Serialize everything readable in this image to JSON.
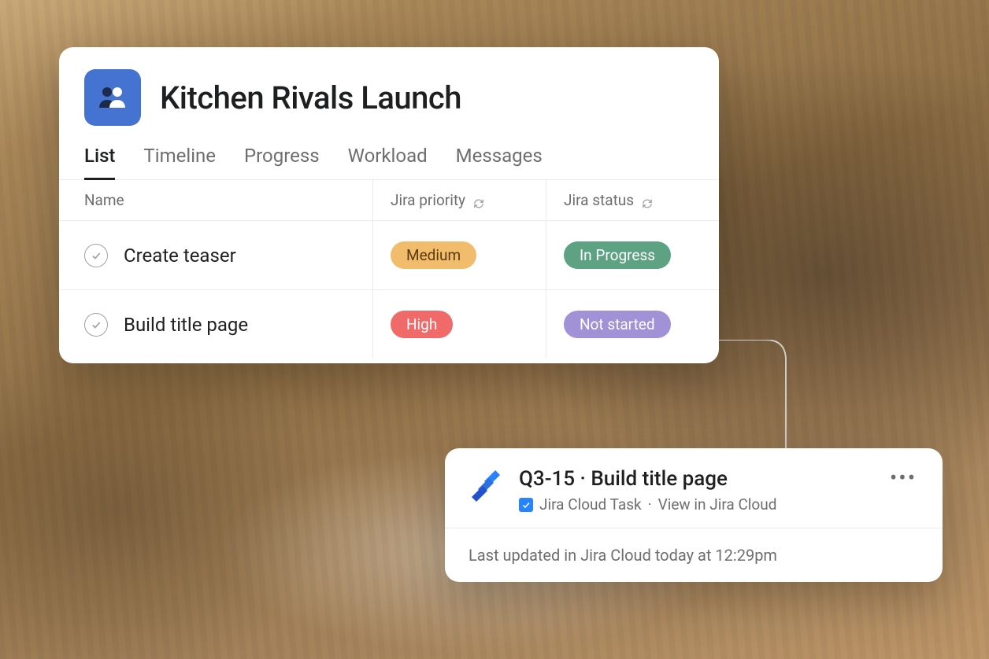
{
  "project": {
    "title": "Kitchen Rivals Launch",
    "tabs": [
      "List",
      "Timeline",
      "Progress",
      "Workload",
      "Messages"
    ],
    "activeTab": 0,
    "columns": {
      "name": "Name",
      "priority": "Jira priority",
      "status": "Jira status"
    },
    "tasks": [
      {
        "name": "Create teaser",
        "priority": "Medium",
        "priorityClass": "pill-medium",
        "status": "In Progress",
        "statusClass": "pill-inprog"
      },
      {
        "name": "Build title page",
        "priority": "High",
        "priorityClass": "pill-high",
        "status": "Not started",
        "statusClass": "pill-notstart"
      }
    ]
  },
  "detail": {
    "id": "Q3-15",
    "title": "Build title page",
    "type": "Jira Cloud Task",
    "viewLink": "View in Jira Cloud",
    "footer": "Last updated in Jira Cloud today at 12:29pm"
  }
}
